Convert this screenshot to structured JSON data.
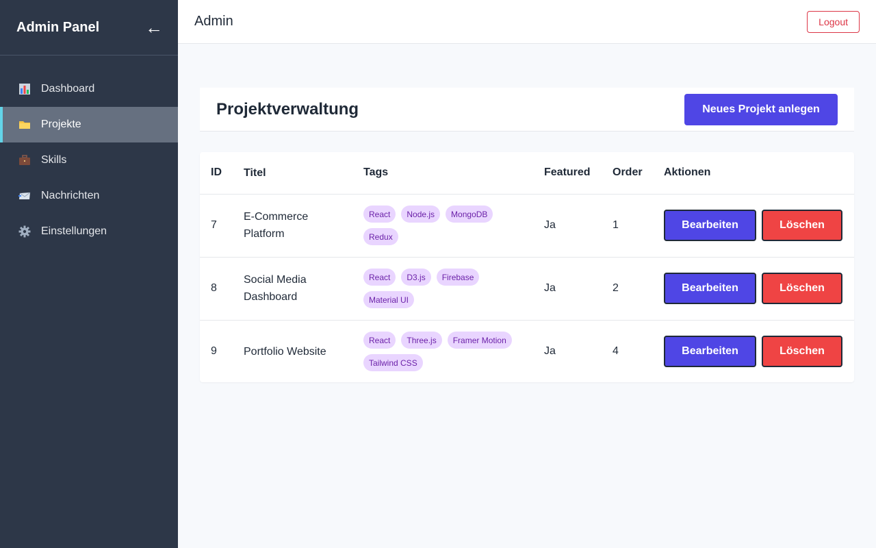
{
  "sidebar": {
    "title": "Admin Panel",
    "collapse_icon": "←",
    "items": [
      {
        "label": "Dashboard",
        "icon": "bar-chart-icon",
        "active": false
      },
      {
        "label": "Projekte",
        "icon": "folder-icon",
        "active": true
      },
      {
        "label": "Skills",
        "icon": "briefcase-icon",
        "active": false
      },
      {
        "label": "Nachrichten",
        "icon": "envelope-icon",
        "active": false
      },
      {
        "label": "Einstellungen",
        "icon": "gear-icon",
        "active": false
      }
    ]
  },
  "topbar": {
    "title": "Admin",
    "logout_label": "Logout"
  },
  "page": {
    "title": "Projektverwaltung",
    "new_project_label": "Neues Projekt anlegen"
  },
  "table": {
    "headers": {
      "id": "ID",
      "title": "Titel",
      "tags": "Tags",
      "featured": "Featured",
      "order": "Order",
      "actions": "Aktionen"
    },
    "rows": [
      {
        "id": "7",
        "title": "E-Commerce Platform",
        "tags": [
          "React",
          "Node.js",
          "MongoDB",
          "Redux"
        ],
        "featured": "Ja",
        "order": "1"
      },
      {
        "id": "8",
        "title": "Social Media Dashboard",
        "tags": [
          "React",
          "D3.js",
          "Firebase",
          "Material UI"
        ],
        "featured": "Ja",
        "order": "2"
      },
      {
        "id": "9",
        "title": "Portfolio Website",
        "tags": [
          "React",
          "Three.js",
          "Framer Motion",
          "Tailwind CSS"
        ],
        "featured": "Ja",
        "order": "4"
      }
    ],
    "edit_label": "Bearbeiten",
    "delete_label": "Löschen"
  },
  "colors": {
    "sidebar_bg": "#2d3748",
    "accent": "#4f46e5",
    "danger": "#ef4444",
    "tag_bg": "#e9d5ff",
    "tag_text": "#6b21a8",
    "active_indicator": "#63d4e8"
  }
}
